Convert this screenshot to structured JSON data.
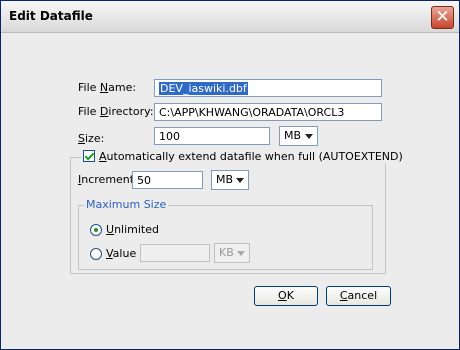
{
  "window": {
    "title": "Edit Datafile",
    "close_glyph": "✕"
  },
  "form": {
    "file_name": {
      "label_pre": "File ",
      "label_mnemonic": "N",
      "label_post": "ame:",
      "value": "DEV_iaswiki.dbf"
    },
    "file_directory": {
      "label_pre": "File ",
      "label_mnemonic": "D",
      "label_post": "irectory:",
      "value": "C:\\APP\\KHWANG\\ORADATA\\ORCL3"
    },
    "size": {
      "label_pre": "",
      "label_mnemonic": "S",
      "label_post": "ize:",
      "value": "100",
      "unit": "MB"
    }
  },
  "autoextend": {
    "checked": true,
    "label_pre": "",
    "label_mnemonic": "A",
    "label_post": "utomatically extend datafile when full (AUTOEXTEND)",
    "increment": {
      "label_pre": "",
      "label_mnemonic": "I",
      "label_post": "ncrement:",
      "value": "50",
      "unit": "MB"
    },
    "maximum_size": {
      "legend": "Maximum Size",
      "unlimited": {
        "label_pre": "",
        "label_mnemonic": "U",
        "label_post": "nlimited",
        "selected": true
      },
      "value": {
        "label_pre": "",
        "label_mnemonic": "V",
        "label_post": "alue",
        "selected": false,
        "input": "",
        "unit": "KB"
      }
    }
  },
  "buttons": {
    "ok": {
      "mnemonic": "O",
      "rest": "K"
    },
    "cancel": {
      "mnemonic": "C",
      "rest": "ancel"
    }
  }
}
